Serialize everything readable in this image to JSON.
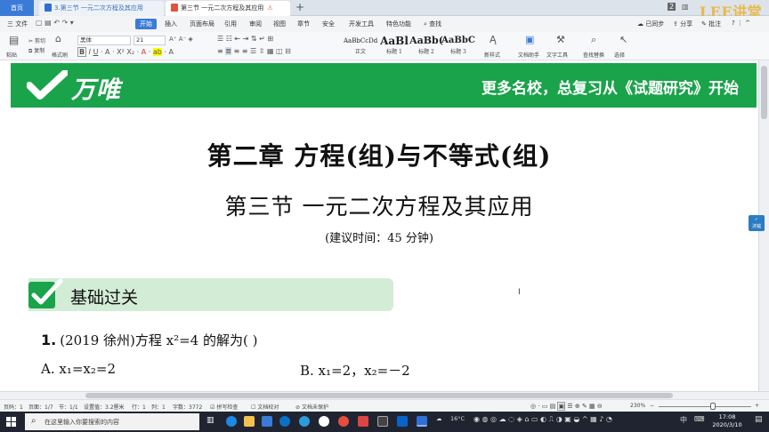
{
  "tabbar": {
    "home": "首页",
    "doc1": "3.第三节 一元二次方程及其应用",
    "doc2": "第三节 一元二次方程及其应用",
    "new_tab": "+",
    "page_badge": "2",
    "brand_watermark": "LEE讲堂"
  },
  "menubar": {
    "file": "三 文件",
    "items": [
      "开始",
      "插入",
      "页面布局",
      "引用",
      "审阅",
      "视图",
      "章节",
      "安全",
      "开发工具",
      "特色功能"
    ],
    "search": "查找",
    "sync": "已同步",
    "share": "分享",
    "comment": "批注"
  },
  "ribbon": {
    "paste": "粘贴",
    "cut": "剪切",
    "copy": "复制",
    "format_painter": "格式刷",
    "font_name": "黑体",
    "font_size": "21",
    "styles": [
      {
        "sample": "AaBbCcDd",
        "label": "正文"
      },
      {
        "sample": "AaBl",
        "label": "标题 1"
      },
      {
        "sample": "AaBb(",
        "label": "标题 2"
      },
      {
        "sample": "AaBbC",
        "label": "标题 3"
      }
    ],
    "new_style": "新样式",
    "doc_assistant": "文档助手",
    "text_tools": "文字工具",
    "find_replace": "查找替换",
    "select": "选择"
  },
  "document": {
    "banner_brand": "万唯",
    "banner_slogan": "更多名校，总复习从《试题研究》开始",
    "chapter_title": "第二章  方程(组)与不等式(组)",
    "section_title": "第三节   一元二次方程及其应用",
    "suggested_time": "(建议时间：45 分钟)",
    "block_title": "基础过关",
    "side_badge": "沐钺",
    "question1": {
      "number": "1.",
      "text": "(2019 徐州)方程 x²=4 的解为(      )",
      "option_a": "A. x₁=x₂=2",
      "option_b": "B. x₁=2，x₂=－2"
    }
  },
  "status": {
    "page_num": "页码：1",
    "page": "页面：1/7",
    "section": "节：1/1",
    "setting": "设置值：3.2厘米",
    "row": "行：1",
    "col": "列：1",
    "word_count": "字数：3772",
    "spell": "拼写检查",
    "proofread": "文档校对",
    "unprotected": "文档未保护",
    "zoom": "230%",
    "zoom_level": 0.55
  },
  "taskbar": {
    "search_placeholder": "在这里输入你要搜索的内容",
    "temperature": "16°C",
    "ime": "中",
    "time": "17:08",
    "date": "2020/3/10"
  },
  "colors": {
    "accent": "#3b7bd8",
    "banner_green": "#1aa34a",
    "section_green": "#d3ecd6",
    "taskbar": "#1f2430"
  }
}
